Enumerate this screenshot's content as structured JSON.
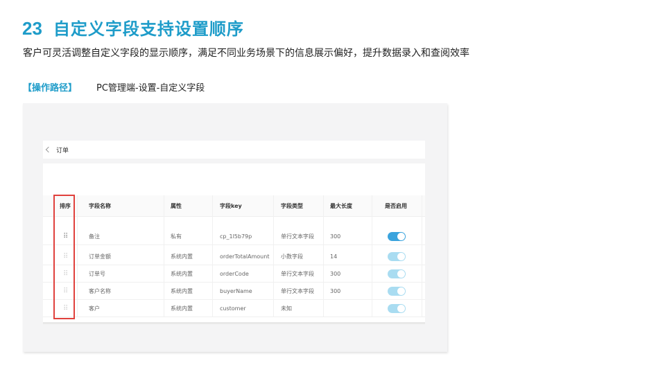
{
  "slide": {
    "number": "23",
    "title": "自定义字段支持设置顺序",
    "subtitle": "客户可灵活调整自定义字段的显示顺序，满足不同业务场景下的信息展示偏好，提升数据录入和查阅效率",
    "path_label": "【操作路径】",
    "path_value": "PC管理端-设置-自定义字段"
  },
  "app": {
    "back_title": "订单",
    "columns": [
      "排序",
      "字段名称",
      "属性",
      "字段key",
      "字段类型",
      "最大长度",
      "是否启用"
    ],
    "rows": [
      {
        "name": "备注",
        "attr": "私有",
        "key": "cp_1l5b79p",
        "type": "单行文本字段",
        "maxlen": "300",
        "enabled": true
      },
      {
        "name": "订单金额",
        "attr": "系统内置",
        "key": "orderTotalAmount",
        "type": "小数字段",
        "maxlen": "14",
        "enabled": true
      },
      {
        "name": "订单号",
        "attr": "系统内置",
        "key": "orderCode",
        "type": "单行文本字段",
        "maxlen": "300",
        "enabled": true
      },
      {
        "name": "客户名称",
        "attr": "系统内置",
        "key": "buyerName",
        "type": "单行文本字段",
        "maxlen": "300",
        "enabled": true
      },
      {
        "name": "客户",
        "attr": "系统内置",
        "key": "customer",
        "type": "未知",
        "maxlen": "",
        "enabled": true
      }
    ],
    "icons": {
      "drag": "drag-handle-icon",
      "back": "chevron-left-icon",
      "toggle": "toggle-switch"
    },
    "colors": {
      "accent": "#1e9cc9",
      "toggle_on": "#3aa3dd",
      "toggle_disabled": "#a9dcf1",
      "highlight": "#e0403c"
    }
  }
}
